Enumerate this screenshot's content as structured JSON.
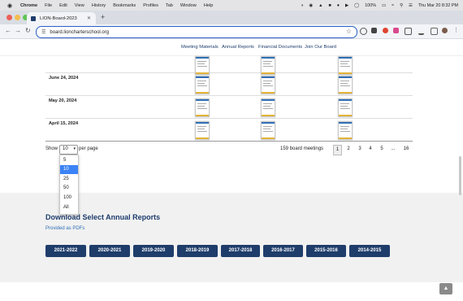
{
  "menubar": {
    "apple": "",
    "items": [
      "Chrome",
      "File",
      "Edit",
      "View",
      "History",
      "Bookmarks",
      "Profiles",
      "Tab",
      "Window",
      "Help"
    ],
    "battery": "100%",
    "clock": "Thu Mar 20  8:32 PM"
  },
  "browser": {
    "tab_title": "LION-Board-2023",
    "url": "board.lioncharterschool.org"
  },
  "site_nav": [
    "Meeting Materials",
    "Annual Reports",
    "Financial Documents",
    "Join Our Board"
  ],
  "table": {
    "rows": [
      {
        "date": ""
      },
      {
        "date": "June 24, 2024"
      },
      {
        "date": "May 20, 2024"
      },
      {
        "date": "April 15, 2024"
      }
    ]
  },
  "pagination": {
    "show_label": "Show",
    "per_page_value": "10",
    "per_page_label": "per page",
    "count_text": "159 board meetings",
    "pages": [
      "1",
      "2",
      "3",
      "4",
      "5",
      "...",
      "16"
    ],
    "current_page": "1",
    "options": [
      "5",
      "10",
      "25",
      "50",
      "100",
      "All"
    ],
    "highlighted_option": "10"
  },
  "reports": {
    "heading": "Download Select Annual Reports",
    "subheading": "Provided as PDFs",
    "years": [
      "2021-2022",
      "2020-2021",
      "2019-2020",
      "2018-2019",
      "2017-2018",
      "2016-2017",
      "2015-2016",
      "2014-2015"
    ]
  },
  "icons": {
    "scroll_top": "chevron-up-icon"
  },
  "colors": {
    "brand_navy": "#1f3d6b",
    "link_blue": "#2f6fb5",
    "option_highlight": "#3b82f6"
  }
}
